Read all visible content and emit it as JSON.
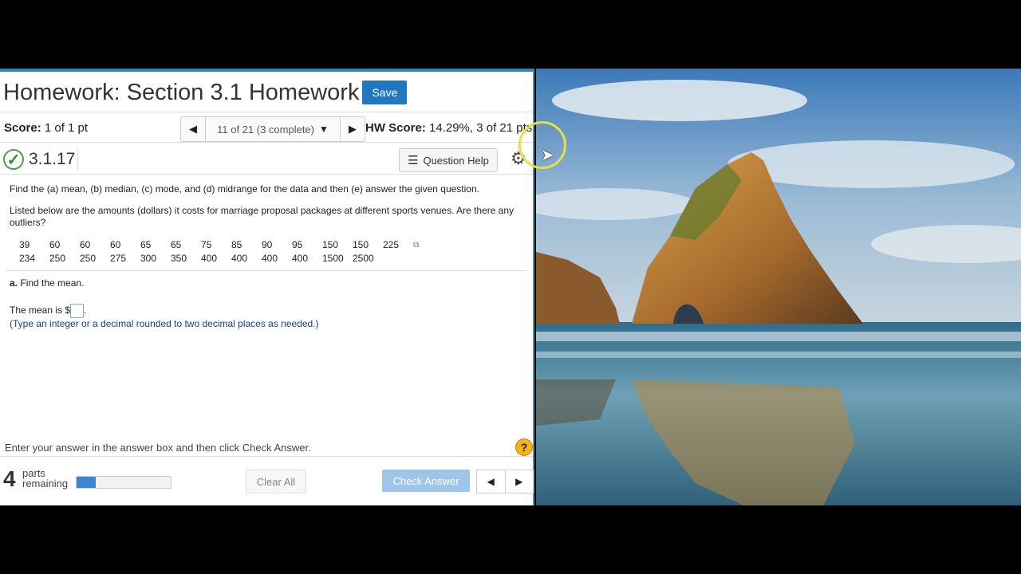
{
  "header": {
    "title": "Homework: Section 3.1 Homework",
    "save_label": "Save"
  },
  "score": {
    "label": "Score:",
    "value": "1 of 1 pt",
    "hw_label": "HW Score:",
    "hw_value": "14.29%, 3 of 21 pts"
  },
  "nav": {
    "prev_icon": "triangle-left",
    "next_icon": "triangle-right",
    "position": "11 of 21 (3 complete)"
  },
  "question": {
    "id": "3.1.17",
    "help_label": "Question Help",
    "instruction": "Find the (a) mean, (b) median, (c) mode, and (d) midrange for the data and then (e) answer the given question.",
    "prompt": "Listed below are the amounts (dollars) it costs for marriage proposal packages at different sports venues. Are there any outliers?",
    "data_row1": [
      "39",
      "60",
      "60",
      "60",
      "65",
      "65",
      "75",
      "85",
      "90",
      "95",
      "150",
      "150",
      "225"
    ],
    "data_row2": [
      "234",
      "250",
      "250",
      "275",
      "300",
      "350",
      "400",
      "400",
      "400",
      "400",
      "1500",
      "2500"
    ],
    "part_a_label": "a.",
    "part_a_text": "Find the mean.",
    "answer_prefix": "The mean is $",
    "answer_suffix": ".",
    "hint": "(Type an integer or a decimal rounded to two decimal places as needed.)"
  },
  "footer": {
    "instruction": "Enter your answer in the answer box and then click Check Answer.",
    "help_icon": "?",
    "parts_count": "4",
    "parts_word": "parts",
    "remaining_word": "remaining",
    "progress_fraction": 0.2,
    "clear_label": "Clear All",
    "check_label": "Check Answer"
  },
  "colors": {
    "accent": "#1f78c1",
    "check_disabled": "#9fc6ea",
    "success": "#4aa24a",
    "help": "#f0b41d"
  }
}
